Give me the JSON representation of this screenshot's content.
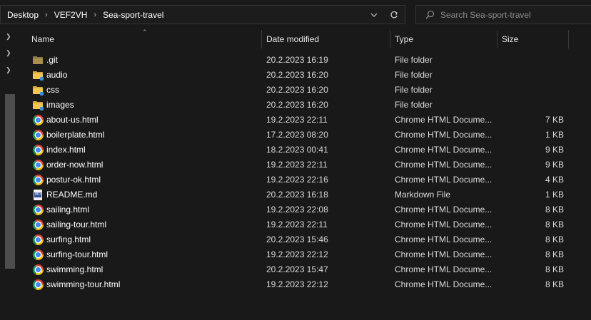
{
  "address": {
    "crumbs": [
      "Desktop",
      "VEF2VH",
      "Sea-sport-travel"
    ]
  },
  "search": {
    "placeholder": "Search Sea-sport-travel"
  },
  "columns": {
    "name": "Name",
    "date": "Date modified",
    "type": "Type",
    "size": "Size"
  },
  "files": [
    {
      "name": ".git",
      "date": "20.2.2023 16:19",
      "type": "File folder",
      "size": "",
      "icon": "git-folder-icon"
    },
    {
      "name": "audio",
      "date": "20.2.2023 16:20",
      "type": "File folder",
      "size": "",
      "icon": "folder-icon"
    },
    {
      "name": "css",
      "date": "20.2.2023 16:20",
      "type": "File folder",
      "size": "",
      "icon": "folder-icon"
    },
    {
      "name": "images",
      "date": "20.2.2023 16:20",
      "type": "File folder",
      "size": "",
      "icon": "folder-icon"
    },
    {
      "name": "about-us.html",
      "date": "19.2.2023 22:11",
      "type": "Chrome HTML Docume...",
      "size": "7 KB",
      "icon": "chrome-icon"
    },
    {
      "name": "boilerplate.html",
      "date": "17.2.2023 08:20",
      "type": "Chrome HTML Docume...",
      "size": "1 KB",
      "icon": "chrome-icon"
    },
    {
      "name": "index.html",
      "date": "18.2.2023 00:41",
      "type": "Chrome HTML Docume...",
      "size": "9 KB",
      "icon": "chrome-icon"
    },
    {
      "name": "order-now.html",
      "date": "19.2.2023 22:11",
      "type": "Chrome HTML Docume...",
      "size": "9 KB",
      "icon": "chrome-icon"
    },
    {
      "name": "postur-ok.html",
      "date": "19.2.2023 22:16",
      "type": "Chrome HTML Docume...",
      "size": "4 KB",
      "icon": "chrome-icon"
    },
    {
      "name": "README.md",
      "date": "20.2.2023 16:18",
      "type": "Markdown File",
      "size": "1 KB",
      "icon": "markdown-file-icon"
    },
    {
      "name": "sailing.html",
      "date": "19.2.2023 22:08",
      "type": "Chrome HTML Docume...",
      "size": "8 KB",
      "icon": "chrome-icon"
    },
    {
      "name": "sailing-tour.html",
      "date": "19.2.2023 22:11",
      "type": "Chrome HTML Docume...",
      "size": "8 KB",
      "icon": "chrome-icon"
    },
    {
      "name": "surfing.html",
      "date": "20.2.2023 15:46",
      "type": "Chrome HTML Docume...",
      "size": "8 KB",
      "icon": "chrome-icon"
    },
    {
      "name": "surfing-tour.html",
      "date": "19.2.2023 22:12",
      "type": "Chrome HTML Docume...",
      "size": "8 KB",
      "icon": "chrome-icon"
    },
    {
      "name": "swimming.html",
      "date": "20.2.2023 15:47",
      "type": "Chrome HTML Docume...",
      "size": "8 KB",
      "icon": "chrome-icon"
    },
    {
      "name": "swimming-tour.html",
      "date": "19.2.2023 22:12",
      "type": "Chrome HTML Docume...",
      "size": "8 KB",
      "icon": "chrome-icon"
    }
  ],
  "colors": {
    "background": "#191919",
    "folder": "#f3c655",
    "text": "#ffffff"
  }
}
